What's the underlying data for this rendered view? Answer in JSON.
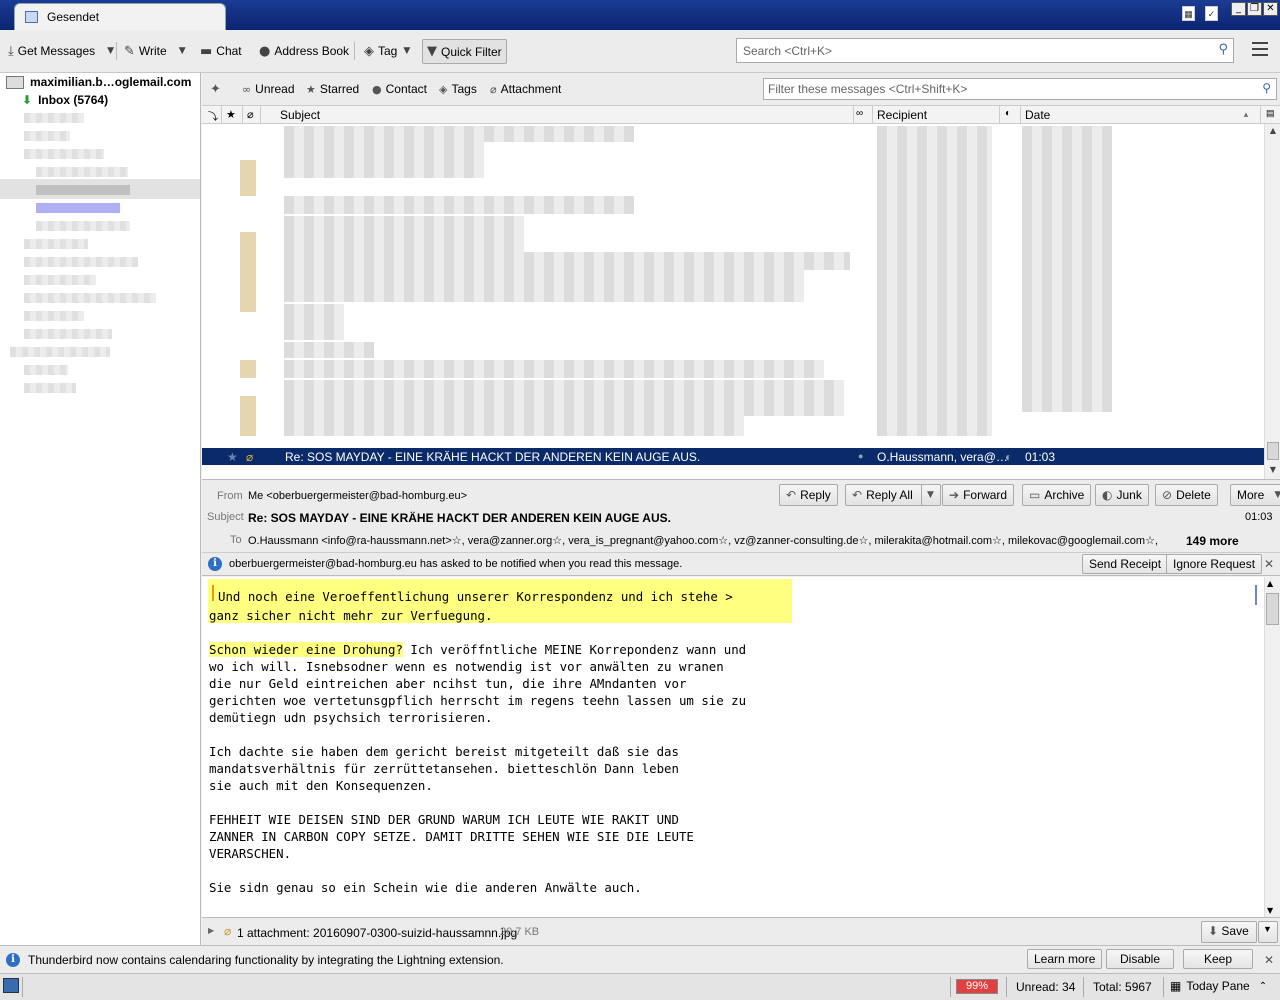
{
  "tab": {
    "title": "Gesendet"
  },
  "window_buttons": [
    "_",
    "❐",
    "✕"
  ],
  "toolbar": {
    "get_messages": "Get Messages",
    "write": "Write",
    "chat": "Chat",
    "address_book": "Address Book",
    "tag": "Tag",
    "quick_filter": "Quick Filter",
    "search_placeholder": "Search <Ctrl+K>"
  },
  "folders": {
    "account": "maximilian.b…oglemail.com",
    "inbox": "Inbox (5764)"
  },
  "quick_filter": {
    "unread": "Unread",
    "starred": "Starred",
    "contact": "Contact",
    "tags": "Tags",
    "attachment": "Attachment",
    "filter_placeholder": "Filter these messages <Ctrl+Shift+K>"
  },
  "columns": {
    "subject": "Subject",
    "recipient": "Recipient",
    "date": "Date"
  },
  "selected_message": {
    "subject": "Re: SOS MAYDAY - EINE KRÄHE HACKT DER ANDEREN KEIN AUGE AUS.",
    "recipient": "O.Haussmann, vera@…",
    "date": "01:03"
  },
  "header": {
    "from_label": "From",
    "from_value": "Me <oberbuergermeister@bad-homburg.eu>",
    "subject_label": "Subject",
    "subject_value": "Re: SOS MAYDAY - EINE KRÄHE HACKT DER ANDEREN KEIN AUGE AUS.",
    "time": "01:03",
    "to_label": "To",
    "to_value": "O.Haussmann <info@ra-haussmann.net>☆, vera@zanner.org☆, vera_is_pregnant@yahoo.com☆, vz@zanner-consulting.de☆, milerakita@hotmail.com☆, milekovac@googlemail.com☆,",
    "more_count": "149 more",
    "buttons": {
      "reply": "Reply",
      "reply_all": "Reply All",
      "forward": "Forward",
      "archive": "Archive",
      "junk": "Junk",
      "delete": "Delete",
      "more": "More"
    }
  },
  "receipt_notice": {
    "text": "oberbuergermeister@bad-homburg.eu has asked to be notified when you read this message.",
    "send_receipt": "Send Receipt",
    "ignore_request": "Ignore Request"
  },
  "body": {
    "quote_lines": [
      "Und noch eine Veroeffentlichung unserer Korrespondenz und ich stehe >",
      "ganz sicher nicht mehr zur Verfuegung."
    ],
    "highlight": "Schon wieder eine Drohung?",
    "para1_first_rest": " Ich veröffntliche MEINE Korrepondenz wann und",
    "para1": [
      "wo ich will. Isnebsodner wenn es notwendig ist vor anwälten zu wranen",
      "die nur Geld eintreichen aber ncihst tun, die ihre AMndanten vor",
      "gerichten woe vertetunsgpflich herrscht im regens teehn lassen um sie zu",
      "demütiegn udn psychsich terrorisieren."
    ],
    "para2": [
      "Ich dachte sie haben dem gericht bereist mitgeteilt daß sie das",
      "mandatsverhältnis für zerrüttetansehen. bietteschlön Dann leben",
      "sie auch mit den Konsequenzen."
    ],
    "para3": [
      "FEHHEIT WIE DEISEN SIND DER GRUND WARUM ICH LEUTE WIE RAKIT UND",
      "ZANNER IN CARBON COPY SETZE. DAMIT DRITTE SEHEN WIE SIE DIE LEUTE",
      "VERARSCHEN."
    ],
    "para4": [
      "Sie sidn genau so ein Schein wie die anderen Anwälte auch."
    ]
  },
  "attachment": {
    "label": "1 attachment: 20160907-0300-suizid-haussamnn.jpg",
    "size": "20,7 KB",
    "save": "Save"
  },
  "lightning": {
    "text": "Thunderbird now contains calendaring functionality by integrating the Lightning extension.",
    "learn_more": "Learn more",
    "disable": "Disable",
    "keep": "Keep"
  },
  "status": {
    "progress_label": "99%",
    "progress": 0.99,
    "unread": "Unread: 34",
    "total": "Total: 5967",
    "today_pane": "Today Pane"
  }
}
